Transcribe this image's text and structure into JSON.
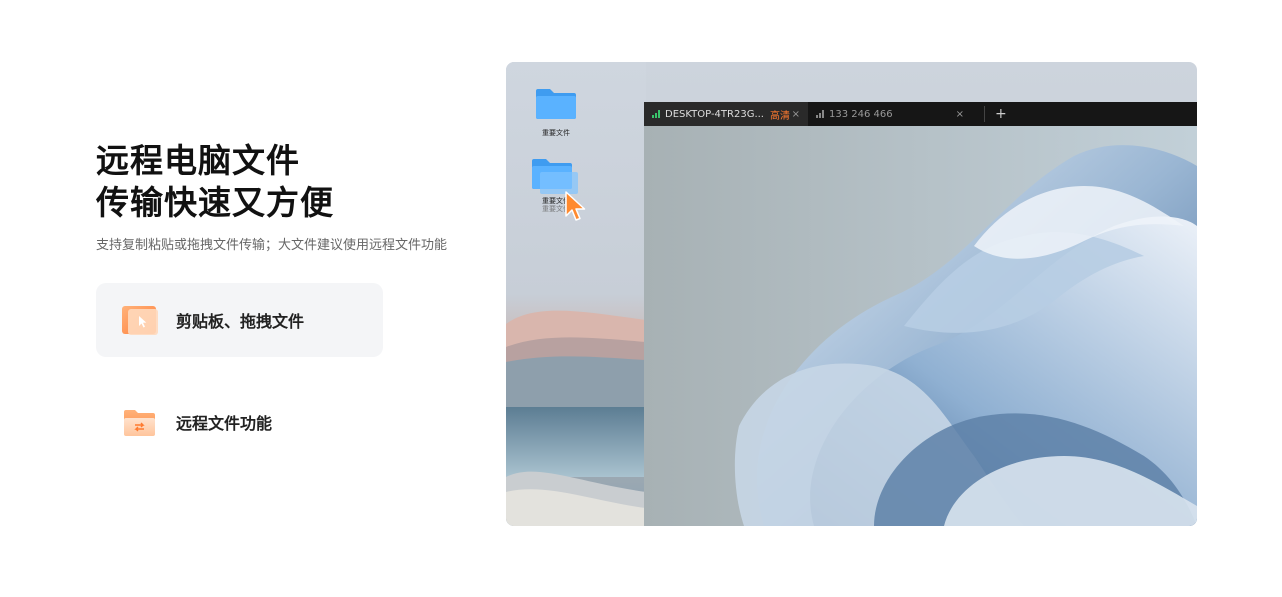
{
  "headline": {
    "line1": "远程电脑文件",
    "line2": "传输快速又方便"
  },
  "subtitle": "支持复制粘贴或拖拽文件传输；大文件建议使用远程文件功能",
  "features": [
    {
      "label": "剪贴板、拖拽文件",
      "icon": "clipboard-drag-icon",
      "active": true
    },
    {
      "label": "远程文件功能",
      "icon": "remote-file-folder-icon",
      "active": false
    }
  ],
  "preview": {
    "desktop_icons": [
      {
        "label": "重要文件"
      },
      {
        "label": "重要文件"
      }
    ],
    "drag_ghost_label": "重要文件",
    "tabs": [
      {
        "name": "DESKTOP-4TR23G...",
        "badge": "高清",
        "close": "×",
        "signal": "green"
      },
      {
        "name": "133 246 466",
        "badge": "",
        "close": "×",
        "signal": "gray"
      }
    ],
    "add_tab": "+"
  },
  "colors": {
    "accent_orange": "#ff7a2f",
    "folder_blue": "#4aa8ff",
    "feature_active_bg": "#f4f5f7"
  }
}
